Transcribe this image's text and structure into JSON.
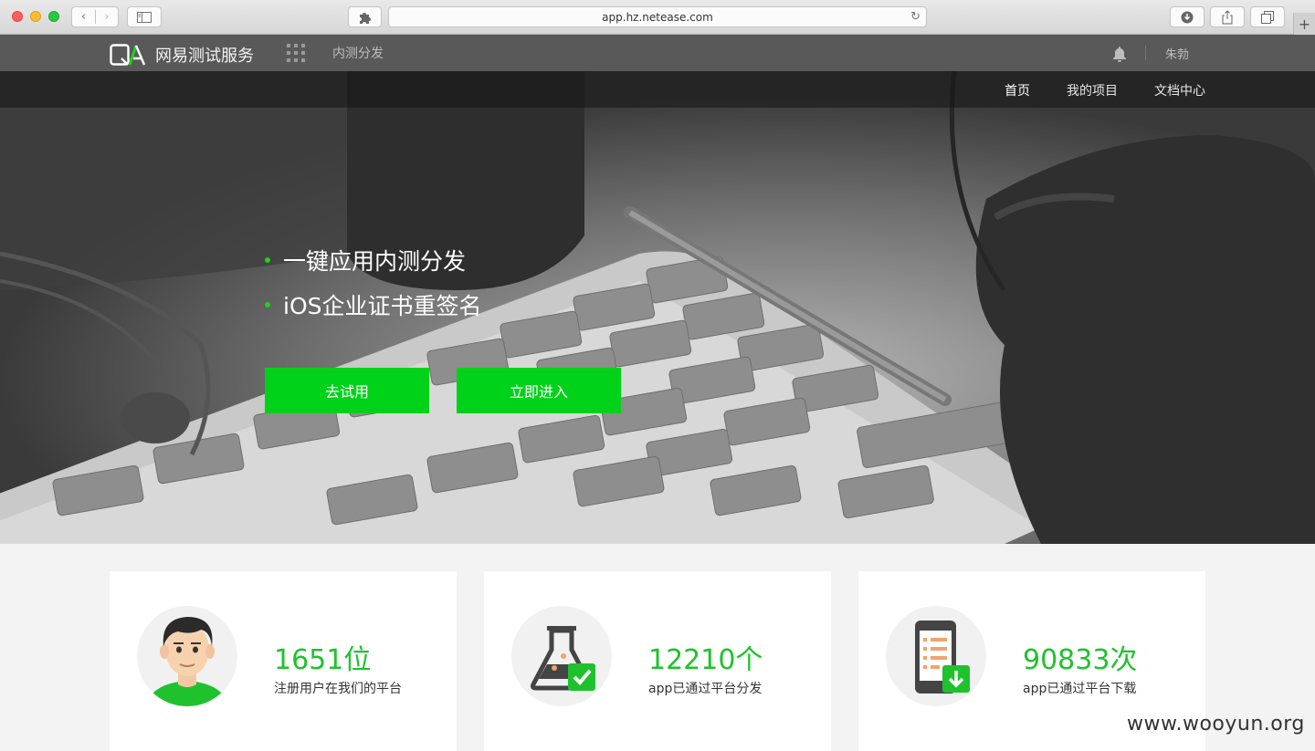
{
  "browser": {
    "url": "app.hz.netease.com",
    "back_glyph": "‹",
    "forward_glyph": "›",
    "newtab_glyph": "+",
    "reload_glyph": "↻"
  },
  "header": {
    "logo_text": "网易测试服务",
    "product_name": "内测分发",
    "username": "朱勃"
  },
  "nav": {
    "items": [
      {
        "label": "首页",
        "active": true
      },
      {
        "label": "我的项目",
        "active": false
      },
      {
        "label": "文档中心",
        "active": false
      }
    ]
  },
  "hero": {
    "features": [
      "一键应用内测分发",
      "iOS企业证书重签名"
    ],
    "try_button": "去试用",
    "enter_button": "立即进入"
  },
  "stats": [
    {
      "number": "1651位",
      "label": "注册用户在我们的平台",
      "icon": "user-avatar-icon"
    },
    {
      "number": "12210个",
      "label": "app已通过平台分发",
      "icon": "flask-check-icon"
    },
    {
      "number": "90833次",
      "label": "app已通过平台下载",
      "icon": "phone-download-icon"
    }
  ],
  "watermark": "www.wooyun.org",
  "colors": {
    "accent_green": "#00d21a",
    "stat_green": "#1fc22d",
    "header_bg": "#595959"
  }
}
